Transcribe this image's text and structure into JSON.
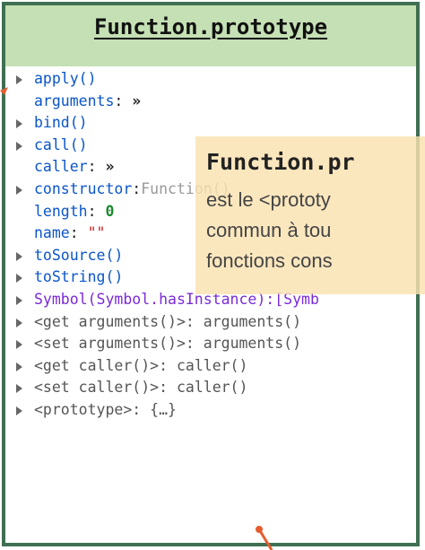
{
  "header": {
    "title": "Function.prototype"
  },
  "properties": [
    {
      "expandable": true,
      "name": "apply()",
      "sep": "",
      "value": "",
      "style": "blue"
    },
    {
      "expandable": false,
      "name": "arguments",
      "sep": ": ",
      "value": "»",
      "style": "blue"
    },
    {
      "expandable": true,
      "name": "bind()",
      "sep": "",
      "value": "",
      "style": "blue"
    },
    {
      "expandable": true,
      "name": "call()",
      "sep": "",
      "value": "",
      "style": "blue"
    },
    {
      "expandable": false,
      "name": "caller",
      "sep": ": ",
      "value": "»",
      "style": "blue"
    },
    {
      "expandable": true,
      "name": "constructor",
      "sep": ":",
      "value": "Function()",
      "style": "blue"
    },
    {
      "expandable": false,
      "name": "length",
      "sep": ": ",
      "value": "0",
      "style": "blue"
    },
    {
      "expandable": false,
      "name": "name",
      "sep": ": ",
      "value": "\"\"",
      "style": "blue"
    },
    {
      "expandable": true,
      "name": "toSource()",
      "sep": "",
      "value": "",
      "style": "blue"
    },
    {
      "expandable": true,
      "name": "toString()",
      "sep": "",
      "value": "",
      "style": "blue"
    },
    {
      "expandable": true,
      "name": "Symbol(Symbol.hasInstance):[Symb",
      "sep": "",
      "value": "",
      "style": "purple"
    },
    {
      "expandable": true,
      "name": "<get arguments()>",
      "sep": ": ",
      "value": "arguments()",
      "style": "gray"
    },
    {
      "expandable": true,
      "name": "<set arguments()>",
      "sep": ": ",
      "value": "arguments()",
      "style": "gray"
    },
    {
      "expandable": true,
      "name": "<get caller()>",
      "sep": ": ",
      "value": "caller()",
      "style": "gray"
    },
    {
      "expandable": true,
      "name": "<set caller()>",
      "sep": ": ",
      "value": "caller()",
      "style": "gray"
    },
    {
      "expandable": true,
      "name": "<prototype>",
      "sep": ": ",
      "value": "{…}",
      "style": "gray"
    }
  ],
  "callout": {
    "title": "Function.pr",
    "lines": [
      "est le <prototy",
      "commun à tou",
      "fonctions cons"
    ]
  },
  "colors": {
    "frame": "#3f6f52",
    "header_bg": "#c5e0b4",
    "callout_bg": "#fae2b0",
    "arrow": "#e65c2e"
  }
}
